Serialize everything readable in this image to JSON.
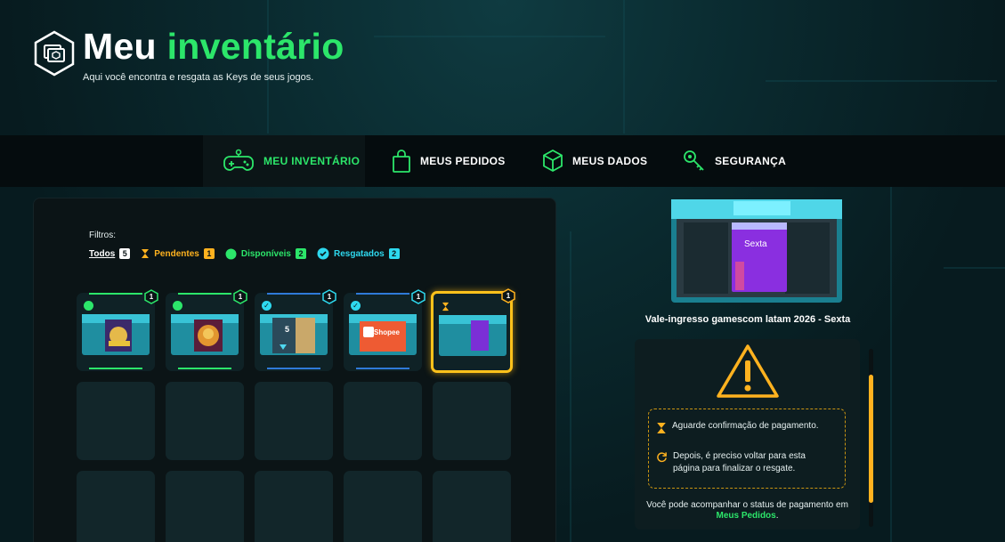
{
  "header": {
    "title_prefix": "Meu",
    "title_accent": "inventário",
    "subtitle": "Aqui você encontra e resgata as Keys de seus jogos."
  },
  "tabs": [
    {
      "label": "MEU INVENTÁRIO",
      "icon": "gamepad-icon",
      "active": true
    },
    {
      "label": "MEUS PEDIDOS",
      "icon": "shopping-bag-icon",
      "active": false
    },
    {
      "label": "MEUS DADOS",
      "icon": "cube-icon",
      "active": false
    },
    {
      "label": "SEGURANÇA",
      "icon": "key-icon",
      "active": false
    }
  ],
  "filters": {
    "label": "Filtros:",
    "items": [
      {
        "label": "Todos",
        "count": "5"
      },
      {
        "label": "Pendentes",
        "count": "1",
        "icon": "hourglass-icon"
      },
      {
        "label": "Disponíveis",
        "count": "2",
        "icon": "dot-icon"
      },
      {
        "label": "Resgatados",
        "count": "2",
        "icon": "check-circle-icon"
      }
    ]
  },
  "inventory": {
    "items": [
      {
        "status": "disponivel",
        "qty": "1",
        "art_text": ""
      },
      {
        "status": "disponivel",
        "qty": "1",
        "art_text": ""
      },
      {
        "status": "resgatado",
        "qty": "1",
        "art_text": "5"
      },
      {
        "status": "resgatado",
        "qty": "1",
        "art_text": "Shopee"
      },
      {
        "status": "pendente",
        "qty": "1",
        "art_text": ""
      }
    ]
  },
  "selected_product": {
    "card_text": "Sexta",
    "title": "Vale-ingresso gamescom latam 2026 - Sexta",
    "notice_line1": "Aguarde confirmação de pagamento.",
    "notice_line2": "Depois, é preciso voltar para esta página para finalizar o resgate.",
    "footer_before": "Você pode acompanhar o status de pagamento em",
    "footer_link": "Meus Pedidos",
    "footer_after": "."
  },
  "colors": {
    "accent_green": "#2ce66a",
    "pending_orange": "#ffb21f",
    "redeemed_cyan": "#2ed9ef"
  }
}
